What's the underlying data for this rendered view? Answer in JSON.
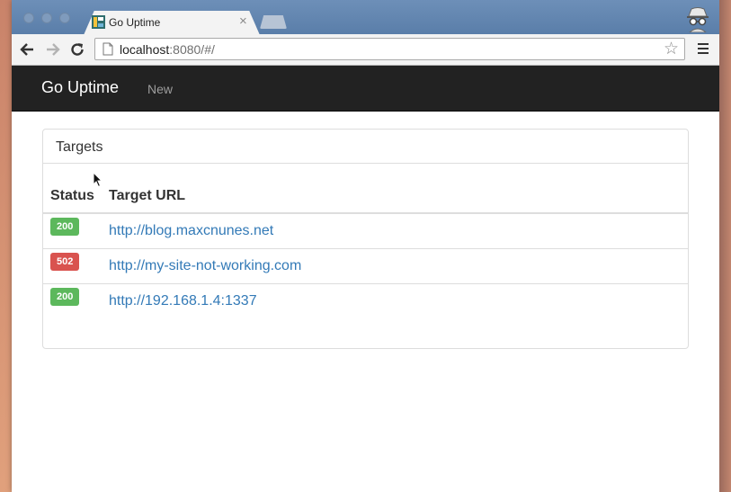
{
  "browser": {
    "tab_title": "Go Uptime",
    "tab_close": "×",
    "url_host": "localhost",
    "url_rest": ":8080/#/",
    "star_glyph": "☆"
  },
  "navbar": {
    "brand": "Go Uptime",
    "links": [
      {
        "label": "New"
      }
    ]
  },
  "panel": {
    "title": "Targets",
    "columns": [
      "Status",
      "Target URL"
    ],
    "rows": [
      {
        "status": "200",
        "url": "http://blog.maxcnunes.net"
      },
      {
        "status": "502",
        "url": "http://my-site-not-working.com"
      },
      {
        "status": "200",
        "url": "http://192.168.1.4:1337"
      }
    ]
  },
  "colors": {
    "navbar_bg": "#222222",
    "status_ok": "#5cb85c",
    "status_error": "#d9534f",
    "link": "#337ab7"
  }
}
